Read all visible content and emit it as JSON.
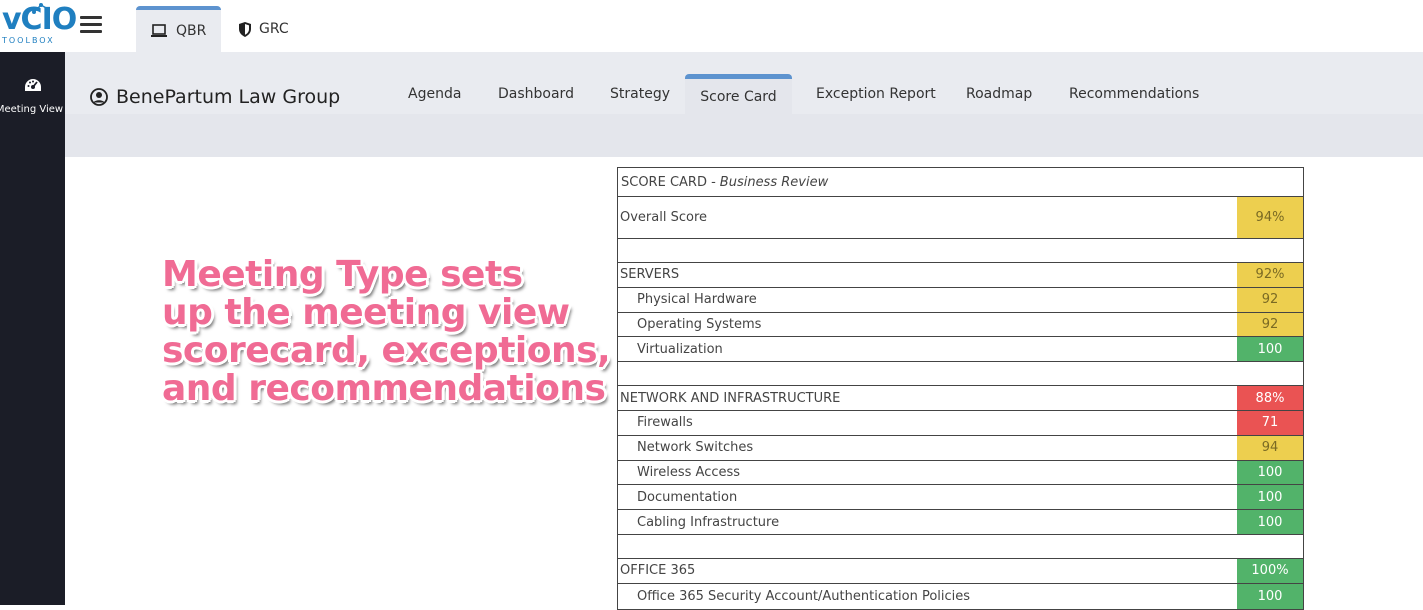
{
  "app": {
    "logo_text": "vCIO",
    "logo_sub": "TOOLBOX"
  },
  "top_tabs": [
    {
      "label": "QBR",
      "icon": "laptop-icon",
      "active": true
    },
    {
      "label": "GRC",
      "icon": "shield-icon",
      "active": false
    }
  ],
  "sidebar": {
    "items": [
      {
        "label": "Meeting View",
        "icon": "dashboard-gauge-icon"
      }
    ]
  },
  "client": {
    "name": "BenePartum Law Group",
    "icon": "user-circle-icon"
  },
  "nav_tabs": [
    {
      "label": "Agenda",
      "active": false
    },
    {
      "label": "Dashboard",
      "active": false
    },
    {
      "label": "Strategy",
      "active": false
    },
    {
      "label": "Score Card",
      "active": true
    },
    {
      "label": "Exception Report",
      "active": false
    },
    {
      "label": "Roadmap",
      "active": false
    },
    {
      "label": "Recommendations",
      "active": false
    }
  ],
  "overlay": {
    "lines": [
      "Meeting Type sets",
      "up the meeting view",
      "scorecard, exceptions,",
      "and recommendations"
    ],
    "color": "#f06b94"
  },
  "scorecard": {
    "title": "SCORE CARD - ",
    "subtitle": "Business Review",
    "overall_label": "Overall Score",
    "overall_score": "94%",
    "sections": [
      {
        "name": "SERVERS",
        "score": "92%",
        "status": "yellow",
        "items": [
          {
            "label": "Physical Hardware",
            "score": "92",
            "status": "yellow"
          },
          {
            "label": "Operating Systems",
            "score": "92",
            "status": "yellow"
          },
          {
            "label": "Virtualization",
            "score": "100",
            "status": "green"
          }
        ]
      },
      {
        "name": "NETWORK AND INFRASTRUCTURE",
        "score": "88%",
        "status": "red",
        "items": [
          {
            "label": "Firewalls",
            "score": "71",
            "status": "red"
          },
          {
            "label": "Network Switches",
            "score": "94",
            "status": "yellow"
          },
          {
            "label": "Wireless Access",
            "score": "100",
            "status": "green"
          },
          {
            "label": "Documentation",
            "score": "100",
            "status": "green"
          },
          {
            "label": "Cabling Infrastructure",
            "score": "100",
            "status": "green"
          }
        ]
      },
      {
        "name": "OFFICE 365",
        "score": "100%",
        "status": "green",
        "items": [
          {
            "label": "Office 365 Security Account/Authentication Policies",
            "score": "100",
            "status": "green"
          }
        ]
      }
    ]
  },
  "colors": {
    "accent": "#5d93cf",
    "sidebar_bg": "#1b1d27",
    "yellow": "#edcf4f",
    "green": "#52b36a",
    "red": "#ea5353"
  }
}
